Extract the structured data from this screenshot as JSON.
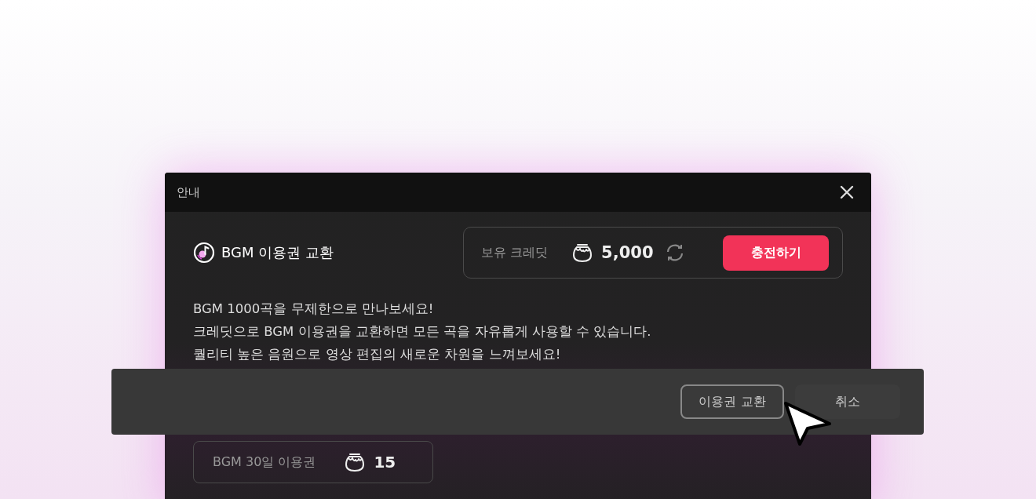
{
  "dialog": {
    "title": "안내"
  },
  "heading": "BGM 이용권 교환",
  "credit": {
    "label": "보유 크레딧",
    "amount": "5,000",
    "charge_button": "충전하기"
  },
  "description": [
    "BGM 1000곡을 무제한으로 만나보세요!",
    "크레딧으로 BGM 이용권을 교환하면 모든 곡을 자유롭게 사용할 수 있습니다.",
    "퀄리티 높은 음원으로 영상 편집의 새로운 차원을 느껴보세요!"
  ],
  "ticket": {
    "name": "BGM 30일 이용권",
    "price": "15"
  },
  "footer": {
    "buttons": [
      {
        "label": "이용권 교환",
        "kind": "outlined"
      },
      {
        "label": "취소",
        "kind": "plain"
      }
    ]
  }
}
